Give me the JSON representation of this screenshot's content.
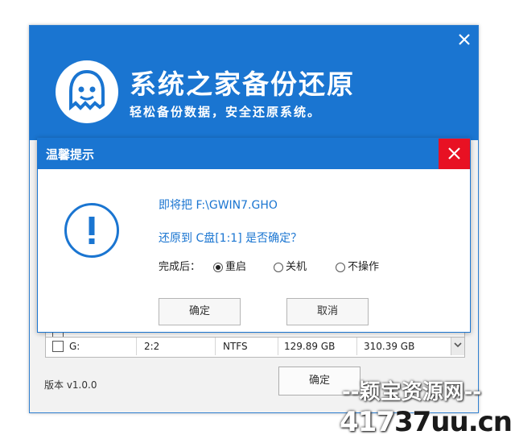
{
  "app": {
    "title": "系统之家备份还原",
    "slogan": "轻松备份数据，安全还原系统。"
  },
  "table": {
    "row": {
      "drive": "G:",
      "index": "2:2",
      "fs": "NTFS",
      "used": "129.89 GB",
      "total": "310.39 GB"
    }
  },
  "footer": {
    "version": "版本 v1.0.0",
    "confirm_label": "确定"
  },
  "dialog": {
    "title": "温馨提示",
    "line1": "即将把 F:\\GWIN7.GHO",
    "line2": "还原到 C盘[1:1] 是否确定？",
    "after_label": "完成后：",
    "options": [
      {
        "label": "重启",
        "selected": true
      },
      {
        "label": "关机",
        "selected": false
      },
      {
        "label": "不操作",
        "selected": false
      }
    ],
    "ok_label": "确定",
    "cancel_label": "取消"
  },
  "watermark": {
    "line1": "--颖宝资源网--",
    "line2_prefix": "417",
    "line2_main": "37uu.cn"
  },
  "colors": {
    "accent": "#1a75d1",
    "close_red": "#e81123"
  }
}
